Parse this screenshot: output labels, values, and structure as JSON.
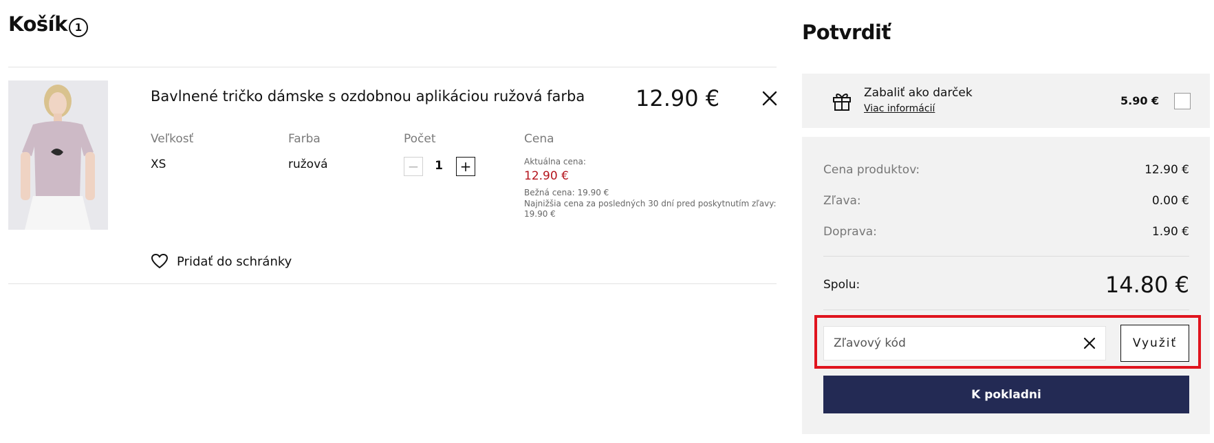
{
  "cart": {
    "title": "Košík",
    "count": "1",
    "item": {
      "name": "Bavlnené tričko dámske s ozdobnou aplikáciou ružová farba",
      "price": "12.90 €",
      "size_label": "Veľkosť",
      "size_value": "XS",
      "color_label": "Farba",
      "color_value": "ružová",
      "qty_label": "Počet",
      "qty_value": "1",
      "qty_minus": "−",
      "qty_plus": "+",
      "price_label": "Cena",
      "current_price_label": "Aktuálna cena:",
      "current_price": "12.90 €",
      "regular_price": "Bežná cena: 19.90 €",
      "lowest_price_note": "Najnižšia cena za posledných 30 dní pred poskytnutím zľavy:",
      "lowest_price_value": "19.90 €"
    },
    "wishlist_label": "Pridať do schránky"
  },
  "summary": {
    "title": "Potvrdiť",
    "gift": {
      "label": "Zabaliť ako darček",
      "link": "Viac informácií",
      "price": "5.90 €",
      "checked": false
    },
    "rows": [
      {
        "label": "Cena produktov:",
        "value": "12.90 €"
      },
      {
        "label": "Zľava:",
        "value": "0.00 €"
      },
      {
        "label": "Doprava:",
        "value": "1.90 €"
      }
    ],
    "total_label": "Spolu:",
    "total_value": "14.80 €",
    "coupon_placeholder": "Zľavový kód",
    "apply_label": "Využiť",
    "checkout_label": "K pokladni"
  },
  "colors": {
    "accent": "#232a54",
    "price_red": "#b4141c",
    "highlight": "#e0141e",
    "panel_bg": "#f2f2f2"
  },
  "icons": [
    "close-icon",
    "heart-icon",
    "gift-icon",
    "minus-icon",
    "plus-icon"
  ]
}
